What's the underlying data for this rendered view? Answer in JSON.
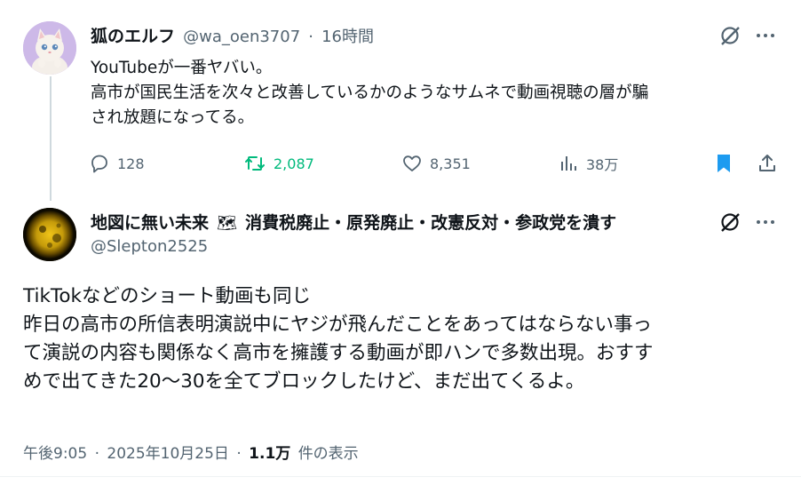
{
  "tweet1": {
    "display_name": "狐のエルフ",
    "handle": "@wa_oen3707",
    "separator": "·",
    "time": "16時間",
    "lines": [
      "YouTubeが一番ヤバい。",
      "高市が国民生活を次々と改善しているかのようなサムネで動画視聴の層が騙",
      "され放題になってる。"
    ],
    "actions": {
      "replies": "128",
      "retweets": "2,087",
      "likes": "8,351",
      "views": "38万"
    }
  },
  "tweet2": {
    "display_name": "地図に無い未来",
    "name_emoji": "🗺",
    "name_suffix": "消費税廃止・原発廃止・改憲反対・参政党を潰す",
    "handle": "@Slepton2525",
    "lines": [
      "TikTokなどのショート動画も同じ",
      "昨日の高市の所信表明演説中にヤジが飛んだことをあってはならない事っ",
      "て演説の内容も関係なく高市を擁護する動画が即ハンで多数出現。おすす",
      "めで出てきた20〜30を全てブロックしたけど、まだ出てくるよ。"
    ],
    "meta": {
      "time": "午後9:05",
      "separator": "·",
      "date": "2025年10月25日",
      "views_count": "1.1万",
      "views_label": "件の表示"
    }
  },
  "colors": {
    "text": "#0f1419",
    "muted": "#536471",
    "retweet": "#00ba7c",
    "bookmark": "#1d9bf0",
    "thread_line": "#cfd9de"
  },
  "icons": [
    "grok-icon",
    "more-icon",
    "reply-icon",
    "retweet-icon",
    "like-icon",
    "views-icon",
    "bookmark-icon",
    "share-icon"
  ]
}
